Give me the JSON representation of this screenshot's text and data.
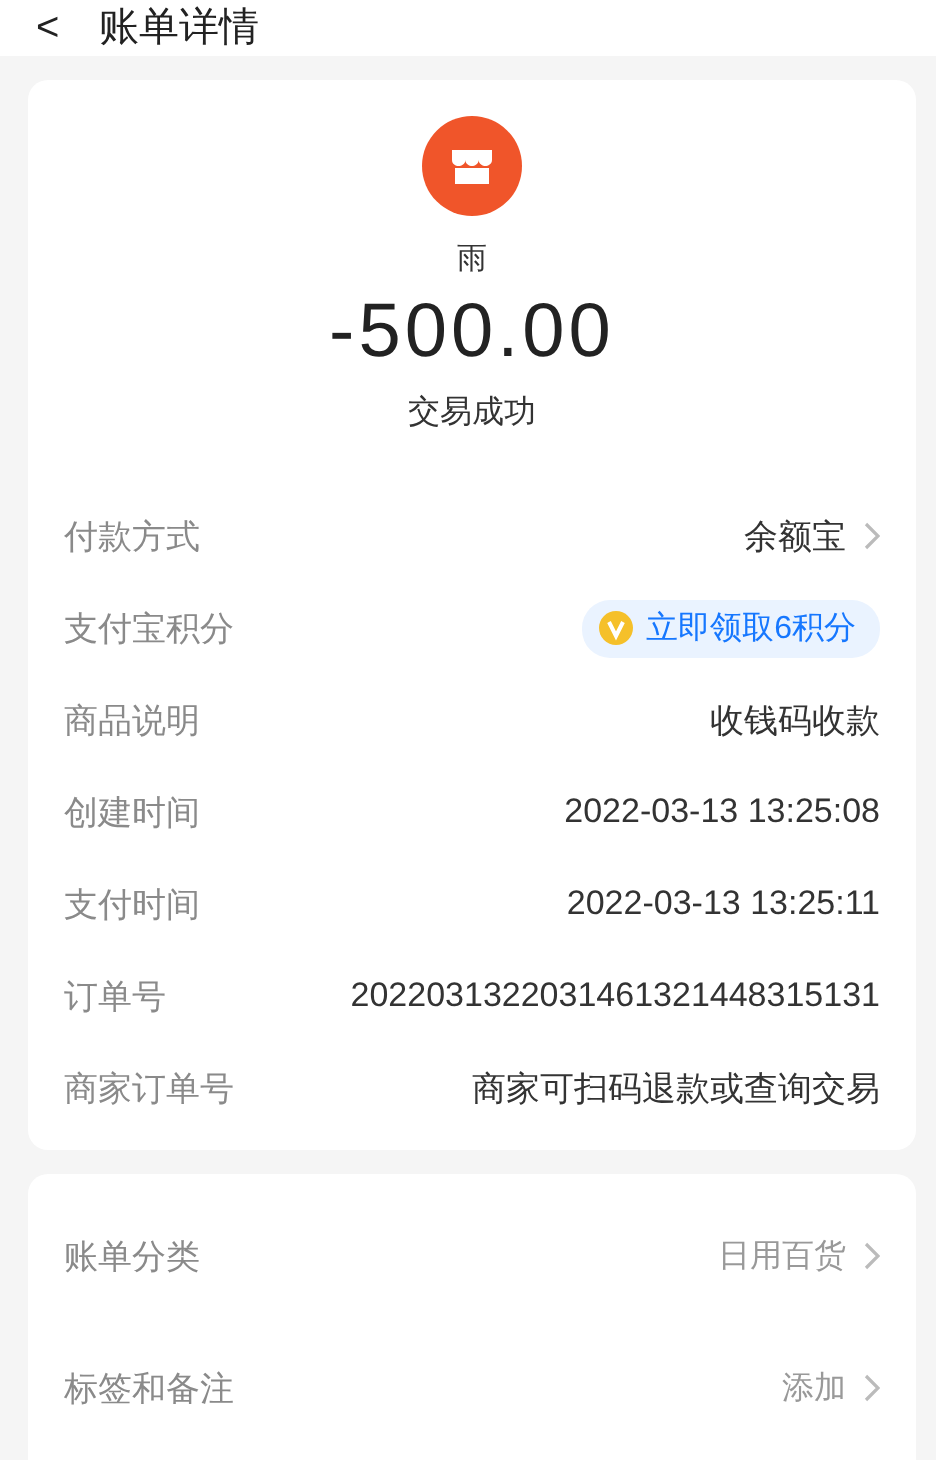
{
  "header": {
    "back": "<",
    "title": "账单详情"
  },
  "summary": {
    "merchant": "雨",
    "amount": "-500.00",
    "status": "交易成功"
  },
  "details": [
    {
      "kind": "link",
      "label": "付款方式",
      "value": "余额宝"
    },
    {
      "kind": "badge",
      "label": "支付宝积分",
      "value": "立即领取6积分"
    },
    {
      "kind": "text",
      "label": "商品说明",
      "value": "收钱码收款"
    },
    {
      "kind": "text",
      "label": "创建时间",
      "value": "2022-03-13 13:25:08"
    },
    {
      "kind": "text",
      "label": "支付时间",
      "value": "2022-03-13 13:25:11"
    },
    {
      "kind": "text",
      "label": "订单号",
      "value": "2022031322031461321448315131"
    },
    {
      "kind": "text",
      "label": "商家订单号",
      "value": "商家可扫码退款或查询交易"
    }
  ],
  "extras": [
    {
      "kind": "link",
      "label": "账单分类",
      "value": "日用百货"
    },
    {
      "kind": "link",
      "label": "标签和备注",
      "value": "添加"
    }
  ]
}
